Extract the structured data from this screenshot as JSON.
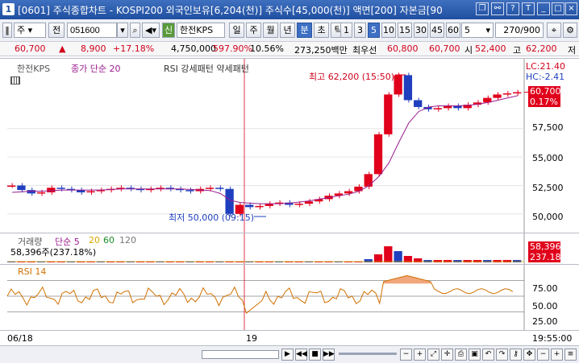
{
  "window": {
    "number": "1",
    "title": "[0601] 주식종합차트 - KOSPI200 외국인보유[6,204(천)] 주식수[45,000(천)] 액면[200] 자본금[90"
  },
  "toolbar": {
    "type_label": "주",
    "jeon_label": "전",
    "code": "051600",
    "shin_badge": "신",
    "stock_name": "한전KPS",
    "periods": [
      "일",
      "주",
      "월",
      "년",
      "분",
      "초",
      "틱"
    ],
    "active_period": "분",
    "intervals": [
      "1",
      "3",
      "5",
      "10",
      "15",
      "30",
      "45",
      "60"
    ],
    "active_interval": "5",
    "interval_select": "5",
    "count": "270/900"
  },
  "quote": {
    "price": "60,700",
    "change": "8,900",
    "change_pct": "+17.18%",
    "volume": "4,750,000",
    "volume_pct": "597.90%",
    "turnover_pct": "10.56%",
    "amount": "273,250백만",
    "best_ask_label": "최우선",
    "best_ask": "60,800",
    "best_bid": "60,700",
    "open_label": "시",
    "open": "52,400",
    "high_label": "고",
    "high": "62,200",
    "ask_cut": "저"
  },
  "price_chart": {
    "legend_name": "한전KPS",
    "legend_ma": "종가 단순 20",
    "legend_rsi": "RSI 강세패턴  약세패턴",
    "high_annotation": "최고 62,200 (15:50)",
    "low_annotation": "최저 50,000 (09:15)",
    "lc_label": "LC:21.40",
    "hc_label": "HC:-2.41",
    "current_price_flag": "60,700",
    "current_pct_flag": "0.17%",
    "y_ticks": [
      "57,500",
      "55,000",
      "52,500",
      "50,000"
    ],
    "colors": {
      "up": "#e0001b",
      "down": "#1f3fbf",
      "ma": "#9b1b8e"
    }
  },
  "volume_chart": {
    "legend": "거래량",
    "legend_ma": "단순 5",
    "ma20": "20",
    "ma60": "60",
    "ma120": "120",
    "value_text": "58,396주(237.18%)",
    "flag_value": "58,396",
    "flag_pct": "237.18%"
  },
  "rsi_chart": {
    "legend": "RSI 14",
    "y_ticks": [
      "75.00",
      "50.00",
      "25.00"
    ]
  },
  "x_axis": {
    "date_left": "06/18",
    "date_mid": "19",
    "time_right": "19:55:00"
  },
  "chart_data": {
    "type": "line",
    "title": "",
    "xlabel": "",
    "ylabel": "",
    "ylim": [
      48500,
      63500
    ],
    "x_first": "06/18",
    "x_second": "19",
    "series": [
      {
        "values": [
          52500,
          52100,
          51800,
          51900,
          52300,
          52200,
          52100,
          51900,
          52000,
          52100,
          52200,
          52300,
          52200,
          52100,
          52200,
          52300,
          52200,
          52100,
          52000,
          52200,
          52300,
          52200,
          50000,
          50800,
          50600,
          50700,
          50900,
          51000,
          50800,
          50900,
          51100,
          51300,
          51600,
          51800,
          52000,
          52400,
          53500,
          57000,
          60500,
          62200,
          60000,
          59400,
          59200,
          59300,
          59500,
          59300,
          59600,
          59800,
          60200,
          60500,
          60600,
          60700
        ]
      },
      {
        "values": [
          51900,
          51950,
          52000,
          52000,
          52050,
          52100,
          52100,
          52100,
          52100,
          52100,
          52150,
          52200,
          52200,
          52200,
          52200,
          52200,
          52200,
          52200,
          52150,
          52100,
          52050,
          51800,
          51200,
          51000,
          50950,
          50900,
          50900,
          50900,
          50950,
          51050,
          51150,
          51300,
          51450,
          51600,
          51750,
          52000,
          52500,
          53300,
          54500,
          56300,
          58000,
          59000,
          59400,
          59500,
          59500,
          59500,
          59550,
          59650,
          59800,
          60000,
          60200,
          60400
        ]
      }
    ],
    "volume_ratio": 237.18,
    "rsi_levels": [
      75,
      50,
      25
    ]
  }
}
